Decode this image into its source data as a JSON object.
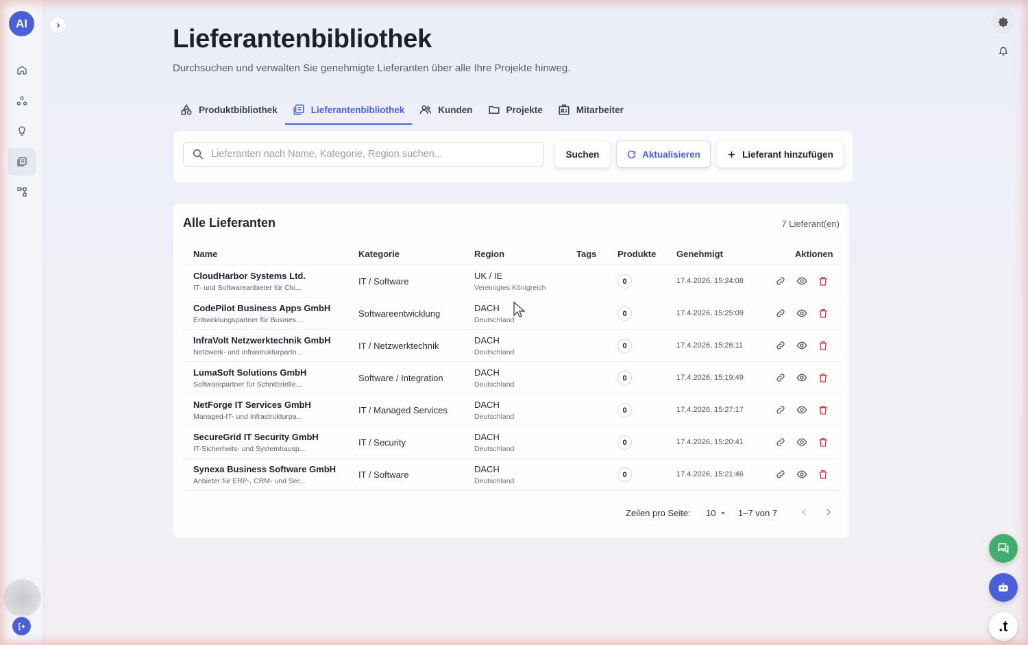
{
  "app": {
    "avatar_text": "AI"
  },
  "page": {
    "title": "Lieferantenbibliothek",
    "subtitle": "Durchsuchen und verwalten Sie genehmigte Lieferanten über alle Ihre Projekte hinweg."
  },
  "tabs": [
    {
      "label": "Produktbibliothek",
      "icon": "shapes-icon",
      "active": false
    },
    {
      "label": "Lieferantenbibliothek",
      "icon": "library-icon",
      "active": true
    },
    {
      "label": "Kunden",
      "icon": "users-icon",
      "active": false
    },
    {
      "label": "Projekte",
      "icon": "folder-icon",
      "active": false
    },
    {
      "label": "Mitarbeiter",
      "icon": "badge-icon",
      "active": false
    }
  ],
  "search": {
    "placeholder": "Lieferanten nach Name, Kategorie, Region suchen...",
    "value": "",
    "search_label": "Suchen",
    "refresh_label": "Aktualisieren",
    "add_label": "Lieferant hinzufügen"
  },
  "table": {
    "title": "Alle Lieferanten",
    "count": "7 Lieferant(en)",
    "columns": {
      "name": "Name",
      "category": "Kategorie",
      "region": "Region",
      "tags": "Tags",
      "products": "Produkte",
      "approved": "Genehmigt",
      "actions": "Aktionen"
    },
    "rows": [
      {
        "name": "CloudHarbor Systems Ltd.",
        "desc": "IT- und Softwareanbieter für Clo...",
        "category": "IT / Software",
        "region": "UK / IE",
        "country": "Vereinigtes Königreich",
        "products": "0",
        "approved": "17.4.2026, 15:24:08"
      },
      {
        "name": "CodePilot Business Apps GmbH",
        "desc": "Entwicklungspartner für Busines...",
        "category": "Softwareentwicklung",
        "region": "DACH",
        "country": "Deutschland",
        "products": "0",
        "approved": "17.4.2026, 15:25:09"
      },
      {
        "name": "InfraVolt Netzwerktechnik GmbH",
        "desc": "Netzwerk- und Infrastrukturpartn...",
        "category": "IT / Netzwerktechnik",
        "region": "DACH",
        "country": "Deutschland",
        "products": "0",
        "approved": "17.4.2026, 15:26:11"
      },
      {
        "name": "LumaSoft Solutions GmbH",
        "desc": "Softwarepartner für Schnittstelle...",
        "category": "Software / Integration",
        "region": "DACH",
        "country": "Deutschland",
        "products": "0",
        "approved": "17.4.2026, 15:19:49"
      },
      {
        "name": "NetForge IT Services GmbH",
        "desc": "Managed-IT- und Infrastrukturpa...",
        "category": "IT / Managed Services",
        "region": "DACH",
        "country": "Deutschland",
        "products": "0",
        "approved": "17.4.2026, 15:27:17"
      },
      {
        "name": "SecureGrid IT Security GmbH",
        "desc": "IT-Sicherheits- und Systemhausp...",
        "category": "IT / Security",
        "region": "DACH",
        "country": "Deutschland",
        "products": "0",
        "approved": "17.4.2026, 15:20:41"
      },
      {
        "name": "Synexa Business Software GmbH",
        "desc": "Anbieter für ERP-, CRM- und Ser...",
        "category": "IT / Software",
        "region": "DACH",
        "country": "Deutschland",
        "products": "0",
        "approved": "17.4.2026, 15:21:46"
      }
    ]
  },
  "pagination": {
    "rows_label": "Zeilen pro Seite:",
    "rows_value": "10",
    "range": "1–7 von 7"
  },
  "fab": {
    "t_label": ".t"
  },
  "colors": {
    "accent": "#4b5fd6",
    "danger": "#d23b3b",
    "chat": "#3fae6e"
  }
}
